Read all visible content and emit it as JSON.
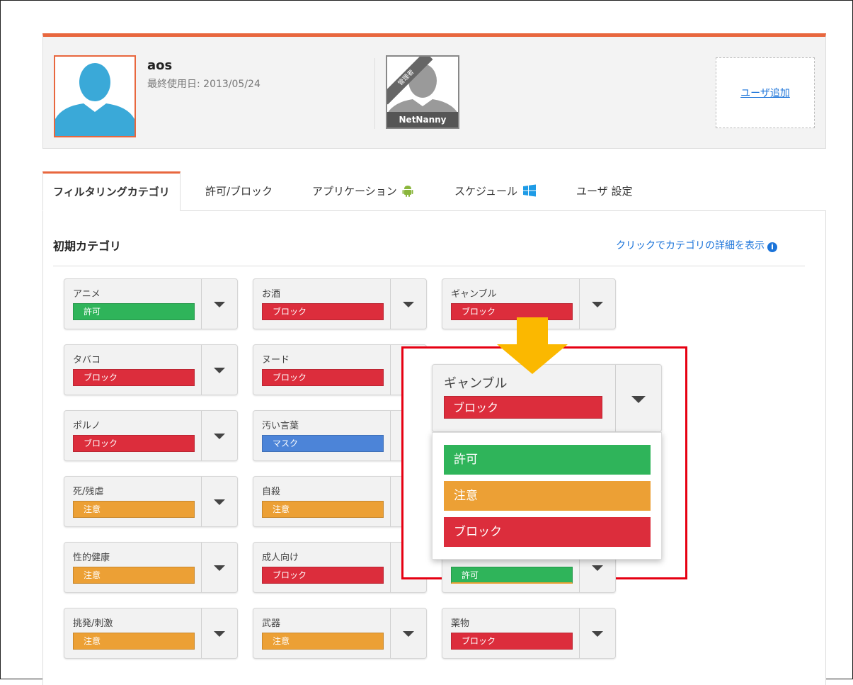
{
  "user": {
    "name": "aos",
    "last_used": "最終使用日: 2013/05/24"
  },
  "admin_profile": {
    "label": "NetNanny",
    "ribbon": "管理者"
  },
  "add_user": {
    "label": "ユーザ追加"
  },
  "tabs": [
    {
      "label": "フィルタリングカテゴリ",
      "active": true
    },
    {
      "label": "許可/ブロック"
    },
    {
      "label": "アプリケーション",
      "icon": "android-icon"
    },
    {
      "label": "スケジュール",
      "icon": "windows-icon"
    },
    {
      "label": "ユーザ 設定"
    }
  ],
  "section": {
    "title": "初期カテゴリ",
    "detail_link": "クリックでカテゴリの詳細を表示"
  },
  "colors": {
    "allow": "#2fb45a",
    "block": "#dc2d3c",
    "caution": "#eca035",
    "mask": "#4c84d8",
    "accent": "#e8673e"
  },
  "categories": [
    {
      "name": "アニメ",
      "status": "許可",
      "kind": "allow"
    },
    {
      "name": "お酒",
      "status": "ブロック",
      "kind": "block"
    },
    {
      "name": "ギャンブル",
      "status": "ブロック",
      "kind": "block"
    },
    {
      "name": "タバコ",
      "status": "ブロック",
      "kind": "block"
    },
    {
      "name": "ヌード",
      "status": "ブロック",
      "kind": "block"
    },
    {
      "name": "ポルノ",
      "status": "ブロック",
      "kind": "block"
    },
    {
      "name": "汚い言葉",
      "status": "マスク",
      "kind": "mask"
    },
    {
      "name": "死/残虐",
      "status": "注意",
      "kind": "caution"
    },
    {
      "name": "自殺",
      "status": "注意",
      "kind": "caution"
    },
    {
      "name": "性的健康",
      "status": "注意",
      "kind": "caution"
    },
    {
      "name": "成人向け",
      "status": "ブロック",
      "kind": "block"
    },
    {
      "name": "挑発/刺激",
      "status": "注意",
      "kind": "caution"
    },
    {
      "name": "武器",
      "status": "注意",
      "kind": "caution"
    },
    {
      "name": "薬物",
      "status": "ブロック",
      "kind": "block"
    }
  ],
  "callout": {
    "card": {
      "name": "ギャンブル",
      "status": "ブロック"
    },
    "options": [
      {
        "label": "許可",
        "kind": "allow"
      },
      {
        "label": "注意",
        "kind": "caution"
      },
      {
        "label": "ブロック",
        "kind": "block"
      }
    ],
    "partial_badge": "許可"
  }
}
